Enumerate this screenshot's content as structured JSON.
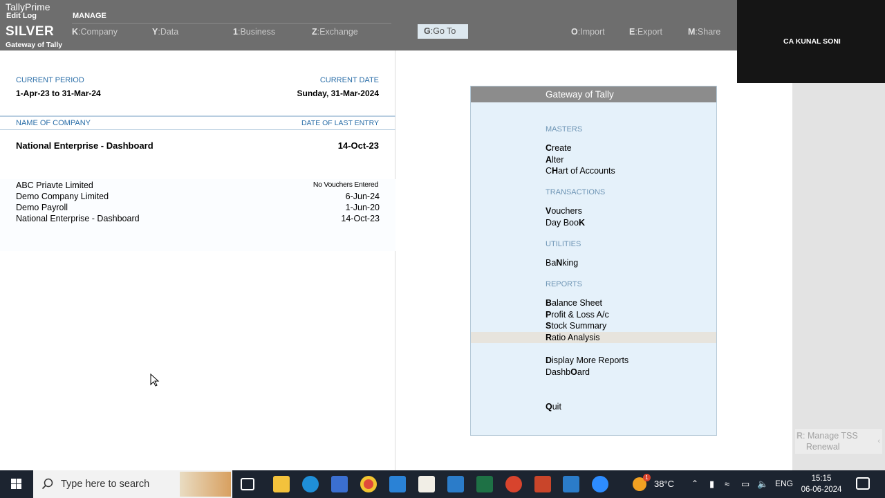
{
  "topbar": {
    "app_name": "TallyPrime",
    "edit_log": "Edit Log",
    "edition": "SILVER",
    "screen": "Gateway of Tally",
    "manage_label": "MANAGE",
    "menu": [
      {
        "key": "K",
        "label": "Company"
      },
      {
        "key": "Y",
        "label": "Data"
      },
      {
        "key": "1",
        "label": "Business"
      },
      {
        "key": "Z",
        "label": "Exchange"
      }
    ],
    "goto": {
      "key": "G",
      "label": "Go To"
    },
    "right_menu": [
      {
        "key": "O",
        "label": "Import"
      },
      {
        "key": "E",
        "label": "Export"
      },
      {
        "key": "M",
        "label": "Share"
      }
    ]
  },
  "video_overlay": {
    "name": "CA KUNAL SONI"
  },
  "left_panel": {
    "current_period_label": "CURRENT PERIOD",
    "current_period": "1-Apr-23 to 31-Mar-24",
    "current_date_label": "CURRENT DATE",
    "current_date": "Sunday, 31-Mar-2024",
    "company_header": "NAME OF COMPANY",
    "last_entry_header": "DATE OF LAST ENTRY",
    "active_company": {
      "name": "National Enterprise - Dashboard",
      "date": "14-Oct-23"
    },
    "companies": [
      {
        "name": "ABC Priavte Limited",
        "date": "No Vouchers Entered"
      },
      {
        "name": "Demo Company Limited",
        "date": "6-Jun-24"
      },
      {
        "name": "Demo Payroll",
        "date": "1-Jun-20"
      },
      {
        "name": "National Enterprise - Dashboard",
        "date": "14-Oct-23"
      }
    ]
  },
  "gateway": {
    "title": "Gateway of Tally",
    "sections": {
      "masters": "MASTERS",
      "transactions": "TRANSACTIONS",
      "utilities": "UTILITIES",
      "reports": "REPORTS"
    },
    "items": {
      "create": {
        "pre": "",
        "key": "C",
        "post": "reate"
      },
      "alter": {
        "pre": "",
        "key": "A",
        "post": "lter"
      },
      "chart": {
        "pre": "C",
        "key": "H",
        "post": "art of Accounts"
      },
      "vouchers": {
        "pre": "",
        "key": "V",
        "post": "ouchers"
      },
      "daybook": {
        "pre": "Day Boo",
        "key": "K",
        "post": ""
      },
      "banking": {
        "pre": "Ba",
        "key": "N",
        "post": "king"
      },
      "balance": {
        "pre": "",
        "key": "B",
        "post": "alance Sheet"
      },
      "pnl": {
        "pre": "",
        "key": "P",
        "post": "rofit & Loss A/c"
      },
      "stock": {
        "pre": "",
        "key": "S",
        "post": "tock Summary"
      },
      "ratio": {
        "pre": "",
        "key": "R",
        "post": "atio Analysis"
      },
      "display": {
        "pre": "",
        "key": "D",
        "post": "isplay More Reports"
      },
      "dashboard": {
        "pre": "Dashb",
        "key": "O",
        "post": "ard"
      },
      "quit": {
        "pre": "",
        "key": "Q",
        "post": "uit"
      }
    }
  },
  "side_button": {
    "key": "R",
    "label": "Manage TSS",
    "label2": "Renewal"
  },
  "taskbar": {
    "search_placeholder": "Type here to search",
    "weather": "38°C",
    "language": "ENG",
    "time": "15:15",
    "date": "06-06-2024",
    "notification_badge": "1"
  },
  "colors": {
    "topbar": "#6e6e6e",
    "gateway_bg": "#e5f1fa",
    "accent_label": "#2a6ea8",
    "taskbar": "#1c2430"
  }
}
